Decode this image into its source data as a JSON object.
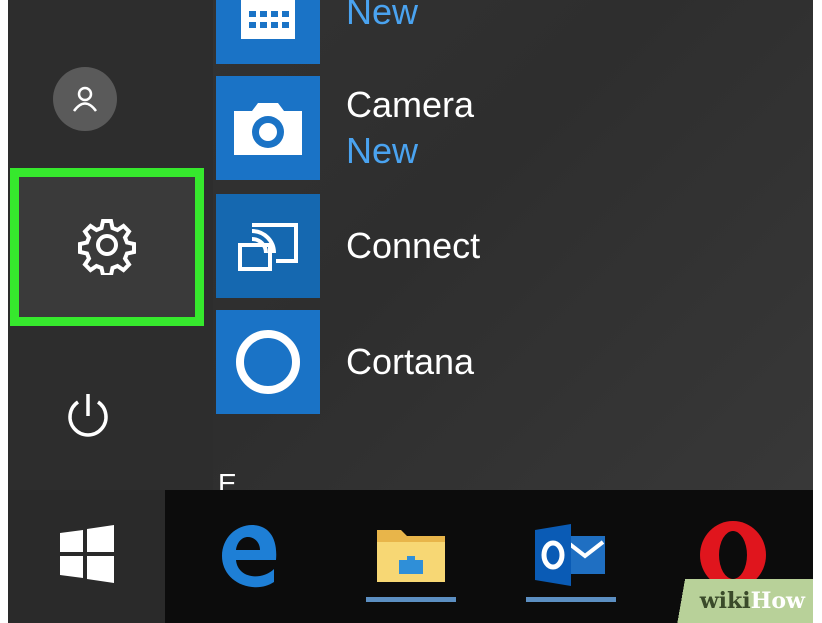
{
  "start_menu": {
    "apps": [
      {
        "name": "",
        "badge": "New",
        "icon": "calendar-icon"
      },
      {
        "name": "Camera",
        "badge": "New",
        "icon": "camera-icon"
      },
      {
        "name": "Connect",
        "badge": "",
        "icon": "connect-icon"
      },
      {
        "name": "Cortana",
        "badge": "",
        "icon": "cortana-icon"
      }
    ],
    "section_letter": "E",
    "rail": [
      "user-icon",
      "gear-icon",
      "power-icon"
    ]
  },
  "taskbar": {
    "icons": [
      "windows-logo-icon",
      "edge-icon",
      "file-explorer-icon",
      "outlook-icon",
      "opera-icon"
    ]
  },
  "watermark": {
    "part1": "wiki",
    "part2": "How"
  },
  "colors": {
    "highlight": "#36e82d",
    "tile": "#1a73c6",
    "badge": "#4aa3f0",
    "taskbar": "#0c0c0c"
  }
}
